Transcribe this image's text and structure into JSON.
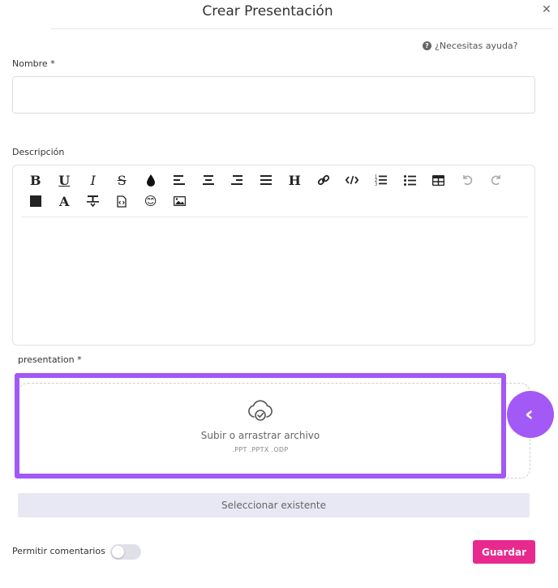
{
  "header": {
    "title": "Crear Presentación"
  },
  "help": {
    "label": "¿Necesitas ayuda?"
  },
  "form": {
    "name_label": "Nombre *",
    "name_value": "",
    "description_label": "Descripción",
    "presentation_label": "presentation *"
  },
  "editor": {
    "toolbar_row1": [
      "bold-icon",
      "underline-icon",
      "italic-icon",
      "strikethrough-icon",
      "text-color-icon",
      "align-left-icon",
      "align-center-icon",
      "align-right-icon",
      "align-justify-icon",
      "heading-icon",
      "link-icon",
      "code-icon",
      "ordered-list-icon",
      "bullet-list-icon",
      "table-icon",
      "undo-icon",
      "redo-icon"
    ],
    "toolbar_row2": [
      "block-icon",
      "font-icon",
      "clear-format-icon",
      "file-code-icon",
      "emoji-icon",
      "image-icon"
    ],
    "heading_glyph": "H",
    "bold_glyph": "B",
    "underline_glyph": "U",
    "italic_glyph": "I",
    "strike_glyph": "S",
    "font_glyph": "A",
    "emoji_glyph": "😊",
    "content": ""
  },
  "upload": {
    "icon": "cloud-check-icon",
    "text": "Subir o arrastrar archivo",
    "formats": ".PPT .PPTX .ODP",
    "highlight_color": "#a259f5"
  },
  "collapse": {
    "glyph": "‹"
  },
  "select_existing": {
    "label": "Seleccionar existente"
  },
  "comments": {
    "label": "Permitir comentarios",
    "enabled": false
  },
  "save": {
    "label": "Guardar",
    "color": "#e8298e"
  }
}
